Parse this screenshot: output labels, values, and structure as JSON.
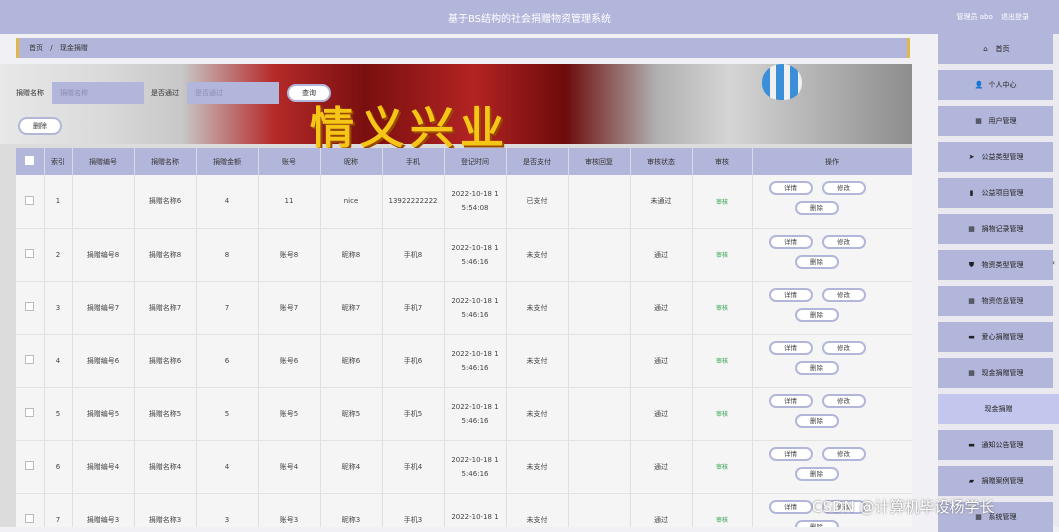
{
  "header": {
    "title": "基于BS结构的社会捐赠物资管理系统",
    "user_label": "管理员 abo",
    "logout": "退出登录"
  },
  "breadcrumb": {
    "home": "首页",
    "sep": "/",
    "current": "现金捐赠"
  },
  "banner": {
    "text": "情义兴业"
  },
  "search": {
    "name_label": "捐赠名称",
    "name_placeholder": "捐赠名称",
    "approved_label": "是否通过",
    "approved_placeholder": "是否通过",
    "query_button": "查询",
    "delete_button": "删除"
  },
  "table": {
    "columns": [
      "索引",
      "捐赠编号",
      "捐赠名称",
      "捐赠金额",
      "账号",
      "昵称",
      "手机",
      "登记时间",
      "是否支付",
      "审核回复",
      "审核状态",
      "审核",
      "操作"
    ],
    "rows": [
      {
        "idx": "1",
        "code": "",
        "name": "捐赠名称6",
        "amount": "4",
        "account": "11",
        "nick": "nice",
        "phone": "13922222222",
        "time1": "2022-10-18 1",
        "time2": "5:54:08",
        "paid": "已支付",
        "reply": "",
        "status": "未通过",
        "audit": "审核"
      },
      {
        "idx": "2",
        "code": "捐赠编号8",
        "name": "捐赠名称8",
        "amount": "8",
        "account": "账号8",
        "nick": "昵称8",
        "phone": "手机8",
        "time1": "2022-10-18 1",
        "time2": "5:46:16",
        "paid": "未支付",
        "reply": "",
        "status": "通过",
        "audit": "审核"
      },
      {
        "idx": "3",
        "code": "捐赠编号7",
        "name": "捐赠名称7",
        "amount": "7",
        "account": "账号7",
        "nick": "昵称7",
        "phone": "手机7",
        "time1": "2022-10-18 1",
        "time2": "5:46:16",
        "paid": "未支付",
        "reply": "",
        "status": "通过",
        "audit": "审核"
      },
      {
        "idx": "4",
        "code": "捐赠编号6",
        "name": "捐赠名称6",
        "amount": "6",
        "account": "账号6",
        "nick": "昵称6",
        "phone": "手机6",
        "time1": "2022-10-18 1",
        "time2": "5:46:16",
        "paid": "未支付",
        "reply": "",
        "status": "通过",
        "audit": "审核"
      },
      {
        "idx": "5",
        "code": "捐赠编号5",
        "name": "捐赠名称5",
        "amount": "5",
        "account": "账号5",
        "nick": "昵称5",
        "phone": "手机5",
        "time1": "2022-10-18 1",
        "time2": "5:46:16",
        "paid": "未支付",
        "reply": "",
        "status": "通过",
        "audit": "审核"
      },
      {
        "idx": "6",
        "code": "捐赠编号4",
        "name": "捐赠名称4",
        "amount": "4",
        "account": "账号4",
        "nick": "昵称4",
        "phone": "手机4",
        "time1": "2022-10-18 1",
        "time2": "5:46:16",
        "paid": "未支付",
        "reply": "",
        "status": "通过",
        "audit": "审核"
      },
      {
        "idx": "7",
        "code": "捐赠编号3",
        "name": "捐赠名称3",
        "amount": "3",
        "account": "账号3",
        "nick": "昵称3",
        "phone": "手机3",
        "time1": "2022-10-18 1",
        "time2": "",
        "paid": "未支付",
        "reply": "",
        "status": "通过",
        "audit": "审核"
      }
    ],
    "ops": {
      "detail": "详情",
      "edit": "修改",
      "delete": "删除"
    }
  },
  "sidebar": {
    "items": [
      {
        "label": "首页",
        "icon": "home-icon",
        "glyph": "⌂"
      },
      {
        "label": "个人中心",
        "icon": "user-icon",
        "glyph": "👤"
      },
      {
        "label": "用户管理",
        "icon": "grid-icon",
        "glyph": "▦"
      },
      {
        "label": "公益类型管理",
        "icon": "send-icon",
        "glyph": "➤"
      },
      {
        "label": "公益项目管理",
        "icon": "bar-chart-icon",
        "glyph": "▮"
      },
      {
        "label": "捐物记录管理",
        "icon": "grid-icon",
        "glyph": "▦"
      },
      {
        "label": "物资类型管理",
        "icon": "shield-icon",
        "glyph": "⛊"
      },
      {
        "label": "物资信息管理",
        "icon": "grid-icon",
        "glyph": "▦"
      },
      {
        "label": "爱心捐赠管理",
        "icon": "box-icon",
        "glyph": "▬"
      },
      {
        "label": "现金捐赠管理",
        "icon": "grid-icon",
        "glyph": "▦"
      },
      {
        "label": "现金捐赠",
        "icon": "",
        "glyph": ""
      },
      {
        "label": "通知公告管理",
        "icon": "box-icon",
        "glyph": "▬"
      },
      {
        "label": "捐赠案例管理",
        "icon": "chat-icon",
        "glyph": "▰"
      },
      {
        "label": "系统管理",
        "icon": "grid-icon",
        "glyph": "▦"
      }
    ]
  },
  "watermark": "CSDN @计算机毕设杨学长"
}
